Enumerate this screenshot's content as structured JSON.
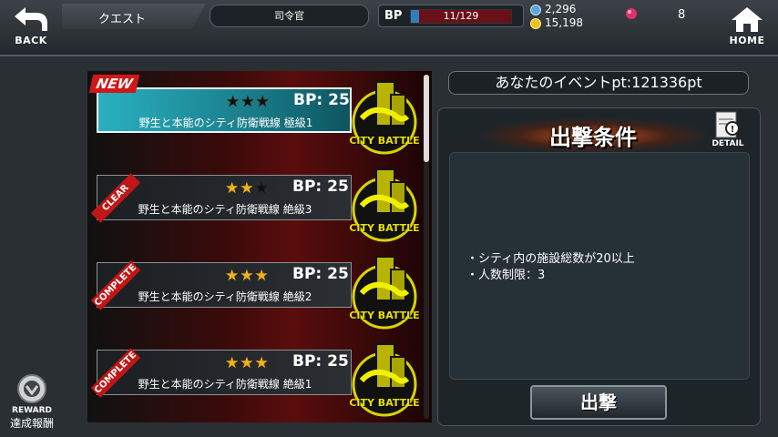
{
  "topbar": {
    "back_label": "BACK",
    "home_label": "HOME",
    "title": "クエスト",
    "rank": "司令官",
    "bp_label": "BP",
    "bp_value": "11/129",
    "bp_fraction": 0.085,
    "currency_a": "2,296",
    "currency_b": "15,198",
    "gem_count": "8"
  },
  "quests": [
    {
      "tag": "NEW",
      "stars_on": "★★★",
      "stars_off": "",
      "bp": "BP: 25",
      "name": "野生と本能のシティ防衛戦線 極級1",
      "badge": "CITY BATTLE"
    },
    {
      "tag": "CLEAR",
      "stars_on": "★★",
      "stars_off": "★",
      "bp": "BP: 25",
      "name": "野生と本能のシティ防衛戦線 絶級3",
      "badge": "CITY BATTLE"
    },
    {
      "tag": "COMPLETE",
      "stars_on": "★★★",
      "stars_off": "",
      "bp": "BP: 25",
      "name": "野生と本能のシティ防衛戦線 絶級2",
      "badge": "CITY BATTLE"
    },
    {
      "tag": "COMPLETE",
      "stars_on": "★★★",
      "stars_off": "",
      "bp": "BP: 25",
      "name": "野生と本能のシティ防衛戦線 絶級1",
      "badge": "CITY BATTLE"
    }
  ],
  "event_pt": "あなたのイベントpt:121336pt",
  "conditions": {
    "title": "出撃条件",
    "detail_label": "DETAIL",
    "detail_top": "QUEST",
    "line1": "・シティ内の施設総数が20以上",
    "line2": "・人数制限：3"
  },
  "sortie_label": "出撃",
  "reward": {
    "en": "REWARD",
    "jp": "達成報酬"
  }
}
